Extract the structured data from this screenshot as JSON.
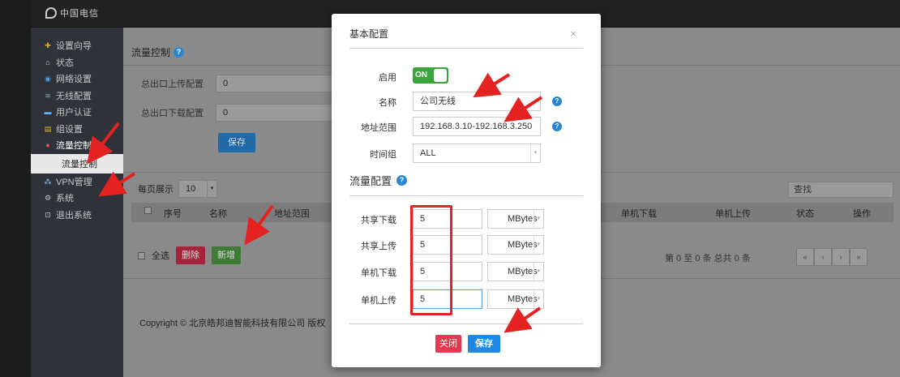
{
  "header": {
    "logo_text": "中国电信"
  },
  "sidebar": {
    "items": [
      {
        "label": "设置向导",
        "icon": "wand-icon"
      },
      {
        "label": "状态",
        "icon": "home-icon"
      },
      {
        "label": "网络设置",
        "icon": "globe-icon"
      },
      {
        "label": "无线配置",
        "icon": "wifi-icon"
      },
      {
        "label": "用户认证",
        "icon": "card-icon"
      },
      {
        "label": "组设置",
        "icon": "group-icon"
      },
      {
        "label": "流量控制",
        "icon": "traffic-icon"
      }
    ],
    "sub_item": "流量控制",
    "items_after": [
      {
        "label": "VPN管理",
        "icon": "vpn-icon"
      },
      {
        "label": "系统",
        "icon": "system-icon"
      },
      {
        "label": "退出系统",
        "icon": "exit-icon"
      }
    ]
  },
  "page": {
    "title": "流量控制",
    "upload_label": "总出口上传配置",
    "upload_value": "0",
    "download_label": "总出口下载配置",
    "download_value": "0",
    "save_label": "保存",
    "per_page_label": "每页展示",
    "per_page_value": "10",
    "search_placeholder": "查找",
    "columns": [
      "序号",
      "名称",
      "地址范围",
      "单机下载",
      "单机上传",
      "状态",
      "操作"
    ],
    "select_all": "全选",
    "delete_label": "删除",
    "add_label": "新增",
    "paging_text": "第 0 至 0 条  总共 0 条",
    "pager": [
      "«",
      "‹",
      "›",
      "»"
    ],
    "copyright": "Copyright © 北京皓邦迪智能科技有限公司 版权"
  },
  "modal": {
    "title": "基本配置",
    "close_x": "×",
    "enable_label": "启用",
    "toggle_text": "ON",
    "name_label": "名称",
    "name_value": "公司无线",
    "range_label": "地址范围",
    "range_value": "192.168.3.10-192.168.3.250",
    "timegroup_label": "时间组",
    "timegroup_value": "ALL",
    "flow_title": "流量配置",
    "rows": [
      {
        "label": "共享下载",
        "value": "5",
        "unit": "MBytes"
      },
      {
        "label": "共享上传",
        "value": "5",
        "unit": "MBytes"
      },
      {
        "label": "单机下载",
        "value": "5",
        "unit": "MBytes"
      },
      {
        "label": "单机上传",
        "value": "5",
        "unit": "MBytes"
      }
    ],
    "close_label": "关闭",
    "save_label": "保存"
  },
  "colors": {
    "accent": "#1e88e5",
    "danger": "#e4394f",
    "success": "#3aa53c",
    "annotation": "#e52222"
  }
}
